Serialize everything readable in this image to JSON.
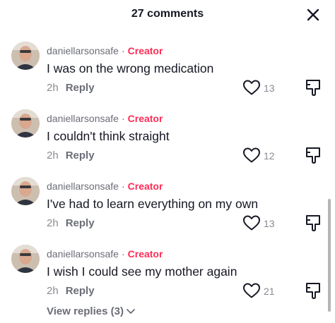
{
  "header": {
    "title": "27 comments",
    "close_icon": "close-icon"
  },
  "comments": [
    {
      "username": "daniellarsonsafe",
      "separator": "·",
      "badge": "Creator",
      "text": "I was on the wrong medication",
      "time": "2h",
      "reply_label": "Reply",
      "like_count": "13"
    },
    {
      "username": "daniellarsonsafe",
      "separator": "·",
      "badge": "Creator",
      "text": "I couldn't think straight",
      "time": "2h",
      "reply_label": "Reply",
      "like_count": "12"
    },
    {
      "username": "daniellarsonsafe",
      "separator": "·",
      "badge": "Creator",
      "text": "I've had to learn everything on my own",
      "time": "2h",
      "reply_label": "Reply",
      "like_count": "13"
    },
    {
      "username": "daniellarsonsafe",
      "separator": "·",
      "badge": "Creator",
      "text": "I wish I could see my mother again",
      "time": "2h",
      "reply_label": "Reply",
      "like_count": "21"
    }
  ],
  "view_replies": {
    "label": "View replies (3)",
    "icon": "chevron-down-icon"
  },
  "icons": {
    "like": "heart-outline-icon",
    "dislike": "thumbs-down-icon"
  },
  "colors": {
    "creator_badge": "#fe2c55",
    "primary_text": "#161823",
    "secondary_text": "#8a8b91"
  }
}
